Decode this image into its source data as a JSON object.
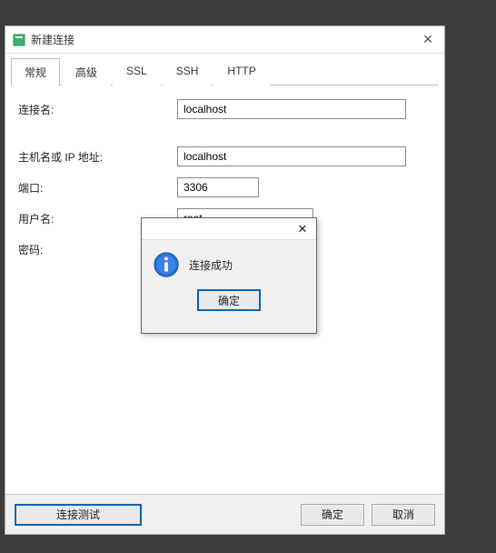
{
  "window": {
    "title": "新建连接"
  },
  "tabs": {
    "items": [
      {
        "label": "常规",
        "active": true
      },
      {
        "label": "高级",
        "active": false
      },
      {
        "label": "SSL",
        "active": false
      },
      {
        "label": "SSH",
        "active": false
      },
      {
        "label": "HTTP",
        "active": false
      }
    ]
  },
  "form": {
    "conn_name_label": "连接名:",
    "conn_name_value": "localhost",
    "host_label": "主机名或 IP 地址:",
    "host_value": "localhost",
    "port_label": "端口:",
    "port_value": "3306",
    "user_label": "用户名:",
    "user_value": "root",
    "pass_label": "密码:",
    "pass_value": ""
  },
  "buttons": {
    "test": "连接测试",
    "ok": "确定",
    "cancel": "取消"
  },
  "modal": {
    "message": "连接成功",
    "ok": "确定"
  }
}
